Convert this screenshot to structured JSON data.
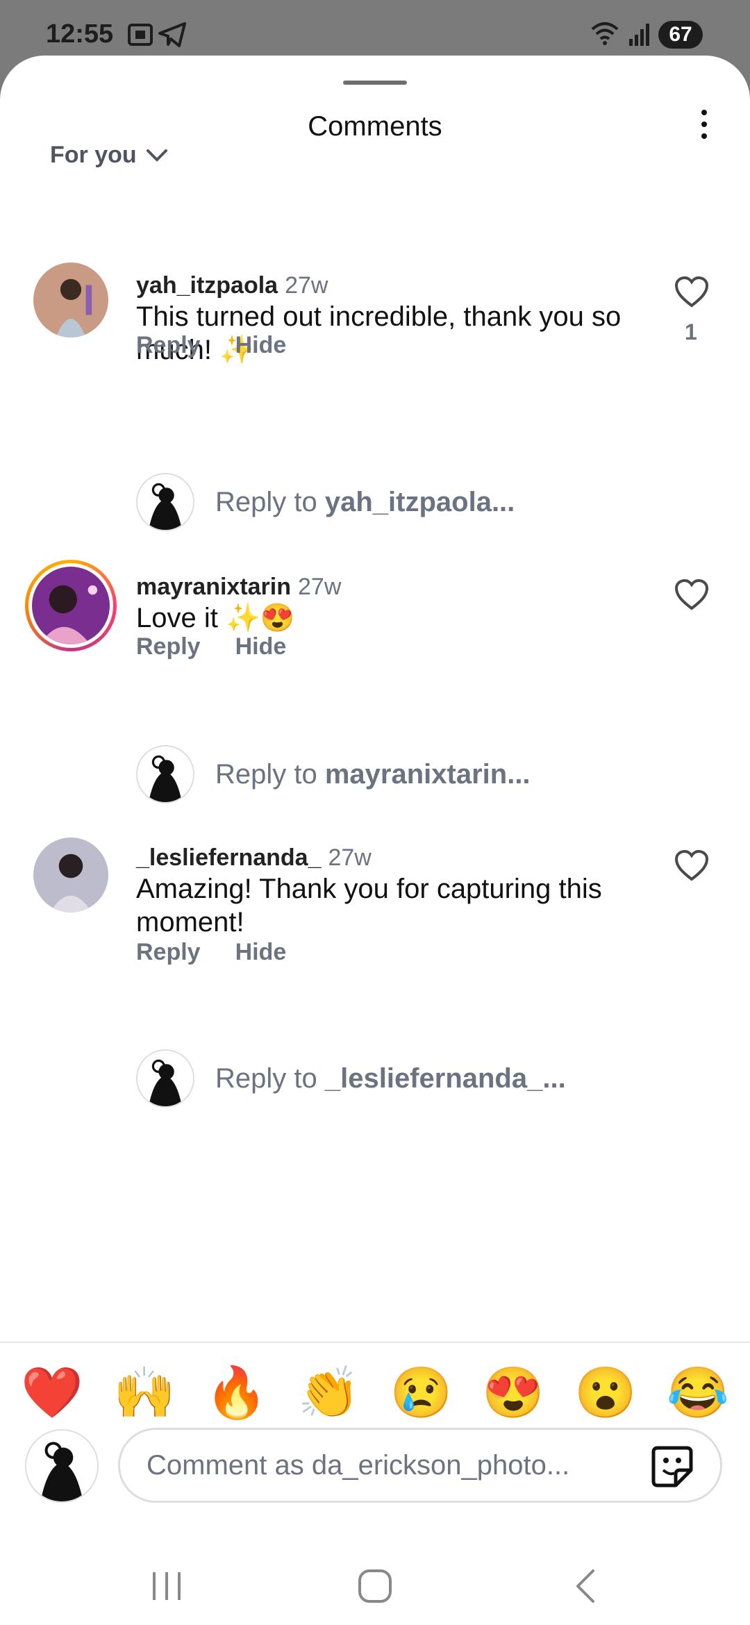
{
  "status": {
    "time": "12:55",
    "battery": "67"
  },
  "sheet": {
    "title": "Comments",
    "filter_label": "For you"
  },
  "comments": [
    {
      "username": "yah_itzpaola",
      "age": "27w",
      "text": "This turned out incredible, thank you so much! ✨",
      "reply_label": "Reply",
      "hide_label": "Hide",
      "likes": "1",
      "reply_prompt": "Reply to ",
      "reply_target": "yah_itzpaola..."
    },
    {
      "username": "mayranixtarin",
      "age": "27w",
      "text": "Love it ✨😍",
      "reply_label": "Reply",
      "hide_label": "Hide",
      "likes": "",
      "reply_prompt": "Reply to ",
      "reply_target": "mayranixtarin..."
    },
    {
      "username": "_lesliefernanda_",
      "age": "27w",
      "text": "Amazing! Thank you for capturing this moment!",
      "reply_label": "Reply",
      "hide_label": "Hide",
      "likes": "",
      "reply_prompt": "Reply to ",
      "reply_target": "_lesliefernanda_..."
    }
  ],
  "emoji_bar": [
    "❤️",
    "🙌",
    "🔥",
    "👏",
    "😢",
    "😍",
    "😮",
    "😂"
  ],
  "composer": {
    "placeholder": "Comment as da_erickson_photo..."
  },
  "icons": {
    "like": "heart-icon",
    "more": "more-vertical-icon",
    "sticker": "sticker-icon",
    "filter": "chevron-down-icon"
  },
  "colors": {
    "muted": "#6b7280",
    "sheet_bg": "#ffffff",
    "status_bg": "#7b7b7b"
  }
}
